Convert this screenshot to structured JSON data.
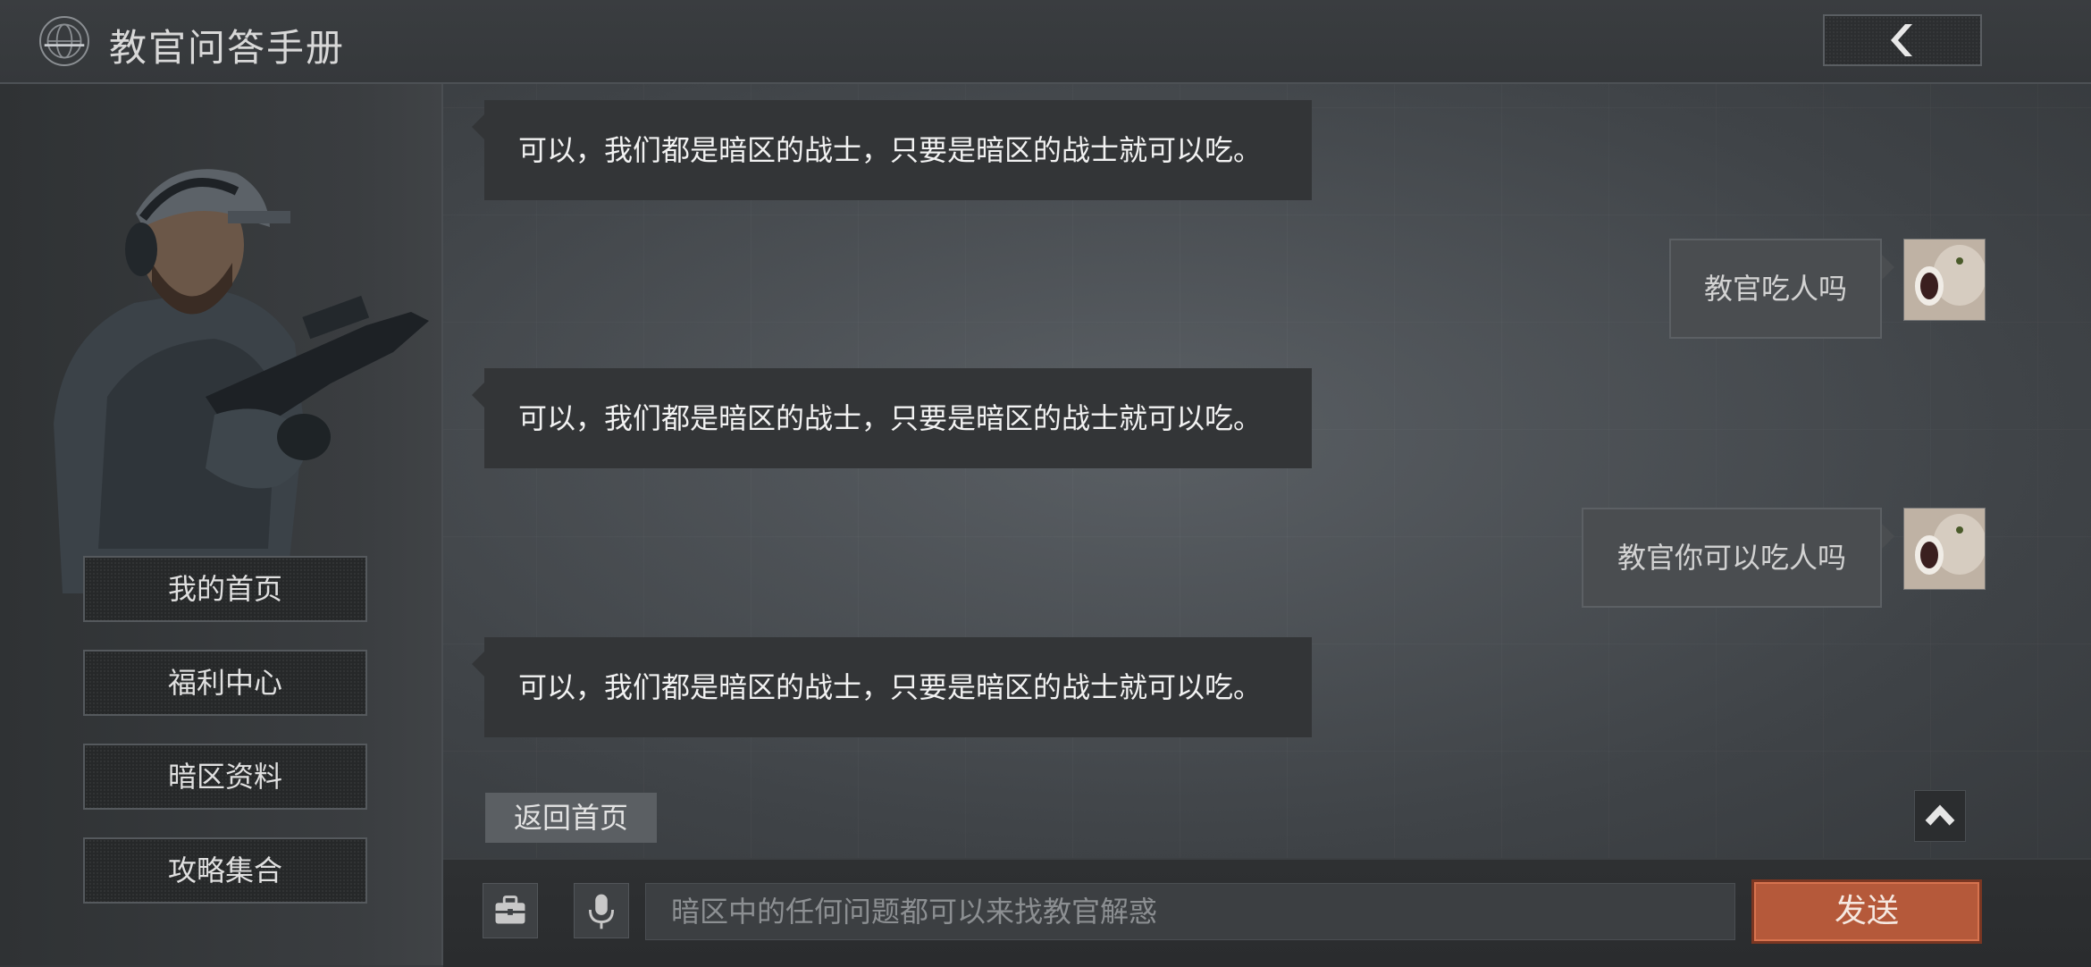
{
  "header": {
    "title": "教官问答手册",
    "logo_icon": "globe-icon",
    "back_icon": "chevron-left-icon"
  },
  "sidebar": {
    "items": [
      {
        "label": "我的首页"
      },
      {
        "label": "福利中心"
      },
      {
        "label": "暗区资料"
      },
      {
        "label": "攻略集合"
      }
    ]
  },
  "chat": {
    "messages": [
      {
        "from": "instructor",
        "text": "可以，我们都是暗区的战士，只要是暗区的战士就可以吃。"
      },
      {
        "from": "user",
        "text": "教官吃人吗"
      },
      {
        "from": "instructor",
        "text": "可以，我们都是暗区的战士，只要是暗区的战士就可以吃。"
      },
      {
        "from": "user",
        "text": "教官你可以吃人吗"
      },
      {
        "from": "instructor",
        "text": "可以，我们都是暗区的战士，只要是暗区的战士就可以吃。"
      }
    ],
    "return_home_label": "返回首页",
    "scroll_up_icon": "chevron-up-icon"
  },
  "composer": {
    "toolkit_icon": "toolbox-icon",
    "voice_icon": "microphone-icon",
    "placeholder": "暗区中的任何问题都可以来找教官解惑",
    "value": "",
    "send_label": "发送"
  },
  "colors": {
    "send_button": "#b5593a",
    "background": "#45494d"
  }
}
